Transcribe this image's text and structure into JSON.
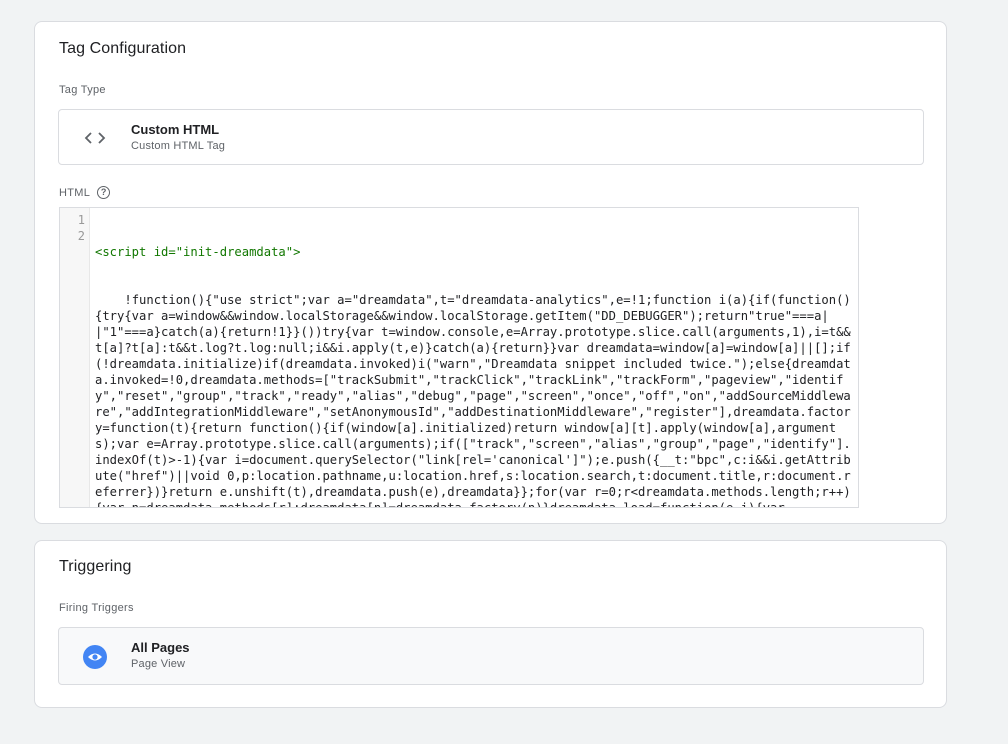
{
  "tag_config": {
    "title": "Tag Configuration",
    "tag_type_label": "Tag Type",
    "tag_type_name": "Custom HTML",
    "tag_type_desc": "Custom HTML Tag",
    "html_label": "HTML",
    "help_glyph": "?",
    "line_numbers": [
      "1",
      "2"
    ],
    "code_line1": "<script id=\"init-dreamdata\">",
    "code_line2": "    !function(){\"use strict\";var a=\"dreamdata\",t=\"dreamdata-analytics\",e=!1;function i(a){if(function(){try{var a=window&&window.localStorage&&window.localStorage.getItem(\"DD_DEBUGGER\");return\"true\"===a||\"1\"===a}catch(a){return!1}}())try{var t=window.console,e=Array.prototype.slice.call(arguments,1),i=t&&t[a]?t[a]:t&&t.log?t.log:null;i&&i.apply(t,e)}catch(a){return}}var dreamdata=window[a]=window[a]||[];if(!dreamdata.initialize)if(dreamdata.invoked)i(\"warn\",\"Dreamdata snippet included twice.\");else{dreamdata.invoked=!0,dreamdata.methods=[\"trackSubmit\",\"trackClick\",\"trackLink\",\"trackForm\",\"pageview\",\"identify\",\"reset\",\"group\",\"track\",\"ready\",\"alias\",\"debug\",\"page\",\"screen\",\"once\",\"off\",\"on\",\"addSourceMiddleware\",\"addIntegrationMiddleware\",\"setAnonymousId\",\"addDestinationMiddleware\",\"register\"],dreamdata.factory=function(t){return function(){if(window[a].initialized)return window[a][t].apply(window[a],arguments);var e=Array.prototype.slice.call(arguments);if([\"track\",\"screen\",\"alias\",\"group\",\"page\",\"identify\"].indexOf(t)>-1){var i=document.querySelector(\"link[rel='canonical']\");e.push({__t:\"bpc\",c:i&&i.getAttribute(\"href\")||void 0,p:location.pathname,u:location.href,s:location.search,t:document.title,r:document.referrer})}return e.unshift(t),dreamdata.push(e),dreamdata}};for(var r=0;r<dreamdata.methods.length;r++){var n=dreamdata.methods[r];dreamdata[n]=dreamdata.factory(n)}dreamdata.load=function(e,i){var"
  },
  "triggering": {
    "title": "Triggering",
    "firing_label": "Firing Triggers",
    "trigger_name": "All Pages",
    "trigger_type": "Page View"
  },
  "colors": {
    "page_bg": "#f1f3f4",
    "card_border": "#dadce0",
    "trigger_icon": "#4285f4",
    "icon_gray": "#5f6368"
  },
  "icons": {
    "tag_type": "code-brackets-icon",
    "trigger": "eye-icon",
    "help": "help-circle-icon"
  }
}
